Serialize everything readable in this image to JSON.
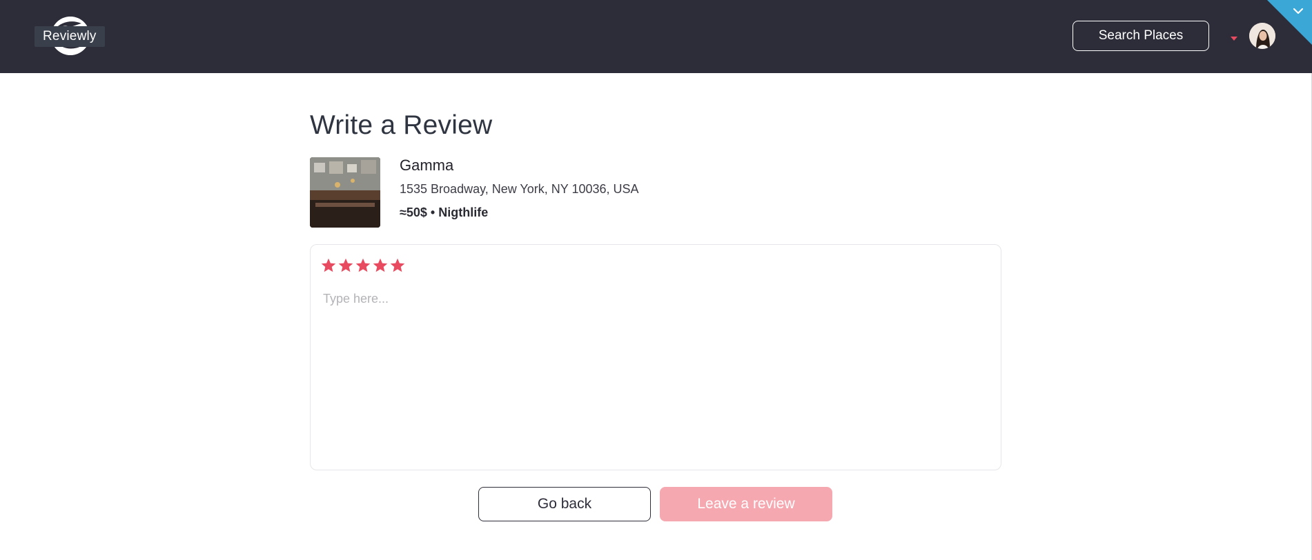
{
  "header": {
    "logo_text": "Reviewly",
    "search_button": "Search Places",
    "accent_color": "#e84a5f",
    "corner_color": "#3aa7d6"
  },
  "page": {
    "title": "Write a Review"
  },
  "place": {
    "name": "Gamma",
    "address": "1535 Broadway, New York, NY 10036, USA",
    "meta": "≈50$ • Nigthlife"
  },
  "review": {
    "rating": 5,
    "rating_max": 5,
    "star_color": "#e84a5f",
    "placeholder": "Type here..."
  },
  "actions": {
    "back": "Go back",
    "submit": "Leave a review"
  }
}
